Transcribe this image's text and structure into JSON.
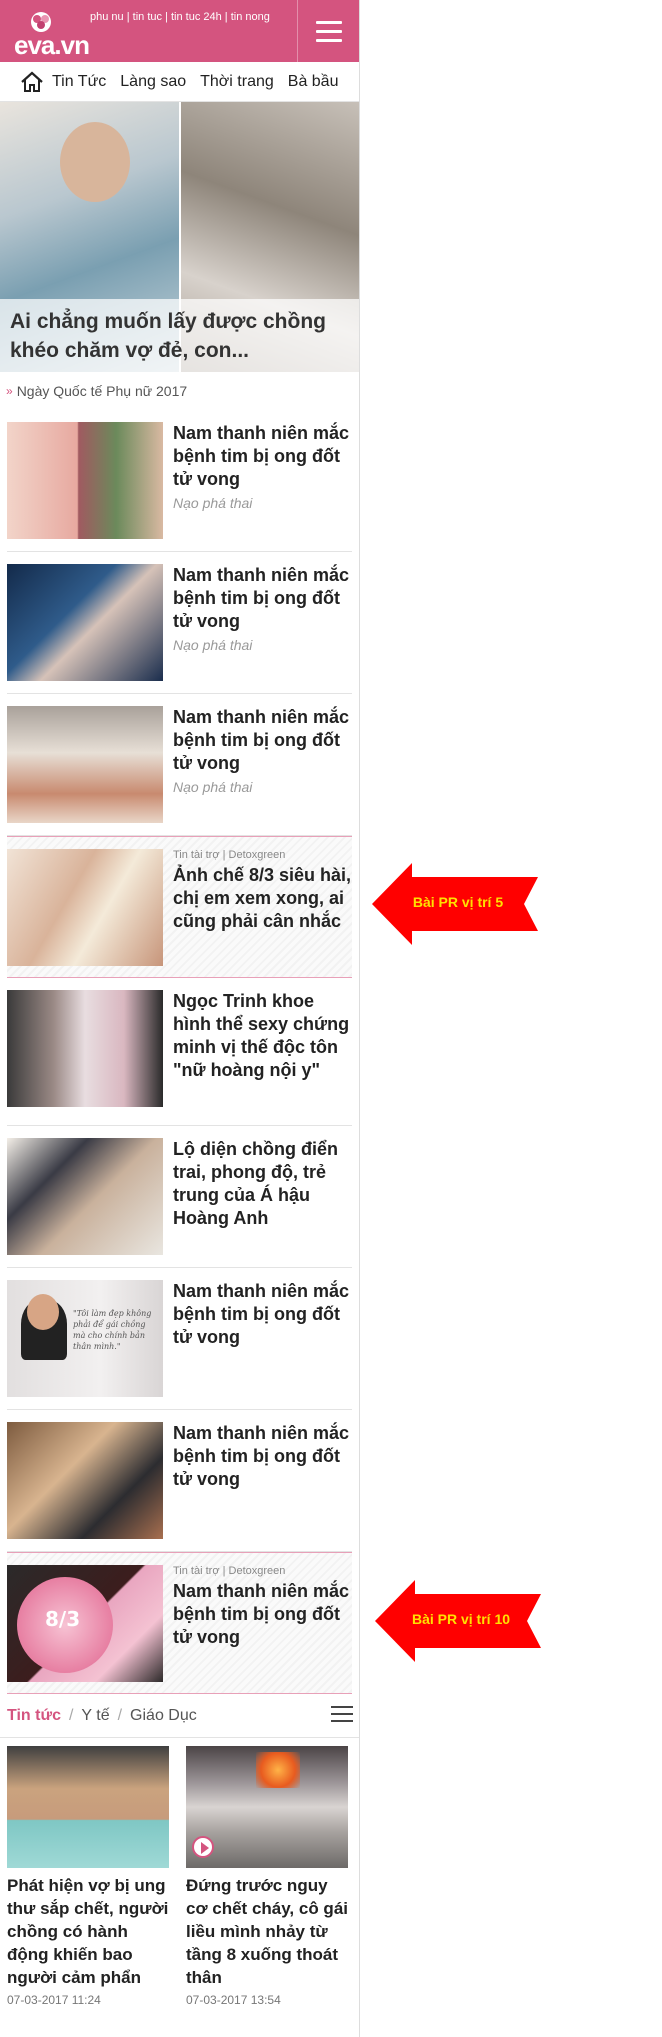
{
  "header": {
    "logo_text": "eva.vn",
    "top_links": [
      "phu nu",
      "tin tuc",
      "tin tuc 24h",
      "tin nong"
    ]
  },
  "nav": {
    "items": [
      "Tin Tức",
      "Làng sao",
      "Thời trang",
      "Bà bầu"
    ]
  },
  "hero": {
    "caption": "Ai chẳng muốn lấy được chồng khéo chăm vợ đẻ, con..."
  },
  "topic": {
    "label": "Ngày Quốc tế Phụ nữ 2017"
  },
  "articles": [
    {
      "title": "Nam thanh niên mắc bệnh tim bị ong đốt tử vong",
      "sub": "Nạo phá thai"
    },
    {
      "title": "Nam thanh niên mắc bệnh tim bị ong đốt tử vong",
      "sub": "Nạo phá thai"
    },
    {
      "title": "Nam thanh niên mắc bệnh tim bị ong đốt tử vong",
      "sub": "Nạo phá thai"
    },
    {
      "sponsor": "Tin tài trợ | Detoxgreen",
      "title": "Ảnh chế 8/3 siêu hài, chị em xem xong, ai cũng phải cân nhắc"
    },
    {
      "title": "Ngọc Trinh khoe hình thể sexy chứng minh vị thế độc tôn \"nữ hoàng nội y\""
    },
    {
      "title": "Lộ diện chồng điển trai, phong độ, trẻ trung của Á hậu Hoàng Anh"
    },
    {
      "title": "Nam thanh niên mắc bệnh tim bị ong đốt tử vong",
      "quote": "\"Tôi làm đẹp không phải để gái chồng mà cho chính bản thân mình.\""
    },
    {
      "title": "Nam thanh niên mắc bệnh tim bị ong đốt tử vong"
    },
    {
      "sponsor": "Tin tài trợ | Detoxgreen",
      "title": "Nam thanh niên mắc bệnh tim bị ong đốt tử vong",
      "cake_text": "8/3"
    }
  ],
  "callouts": {
    "pr5": "Bài PR vị trí 5",
    "pr10": "Bài PR vị trí 10"
  },
  "section": {
    "active_tab": "Tin tức",
    "tabs": [
      "Y tế",
      "Giáo Dục"
    ]
  },
  "grid": [
    {
      "title": "Phát hiện vợ bị ung thư sắp chết, người chồng có hành động khiến bao người cảm phẩn",
      "date": "07-03-2017 11:24"
    },
    {
      "title": "Đứng trước nguy cơ chết cháy, cô gái liều mình nhảy từ tầng 8 xuống thoát thân",
      "date": "07-03-2017 13:54"
    }
  ],
  "colors": {
    "brand_pink": "#d4547f",
    "callout_red": "#ff0000",
    "callout_text": "#ffe100"
  }
}
